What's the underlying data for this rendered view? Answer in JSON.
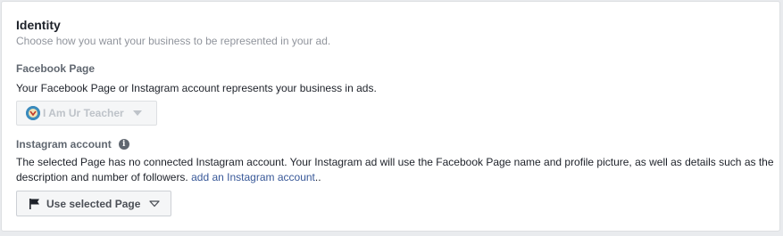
{
  "identity": {
    "title": "Identity",
    "subtitle": "Choose how you want your business to be represented in your ad."
  },
  "facebook_page": {
    "label": "Facebook Page",
    "description": "Your Facebook Page or Instagram account represents your business in ads.",
    "selected_page": "I Am Ur Teacher",
    "avatar_icon": "page-avatar-icon",
    "disabled": true
  },
  "instagram": {
    "label": "Instagram account",
    "info_icon": "info-icon",
    "description": "The selected Page has no connected Instagram account. Your Instagram ad will use the Facebook Page name and profile picture, as well as details such as the description and number of followers.",
    "link_text": "add an Instagram account",
    "link_suffix": "..",
    "button_label": "Use selected Page",
    "button_icon": "flag-icon"
  },
  "colors": {
    "link": "#385898",
    "muted_text": "#90949c",
    "label_text": "#606770",
    "disabled_text": "#bec3c9"
  }
}
